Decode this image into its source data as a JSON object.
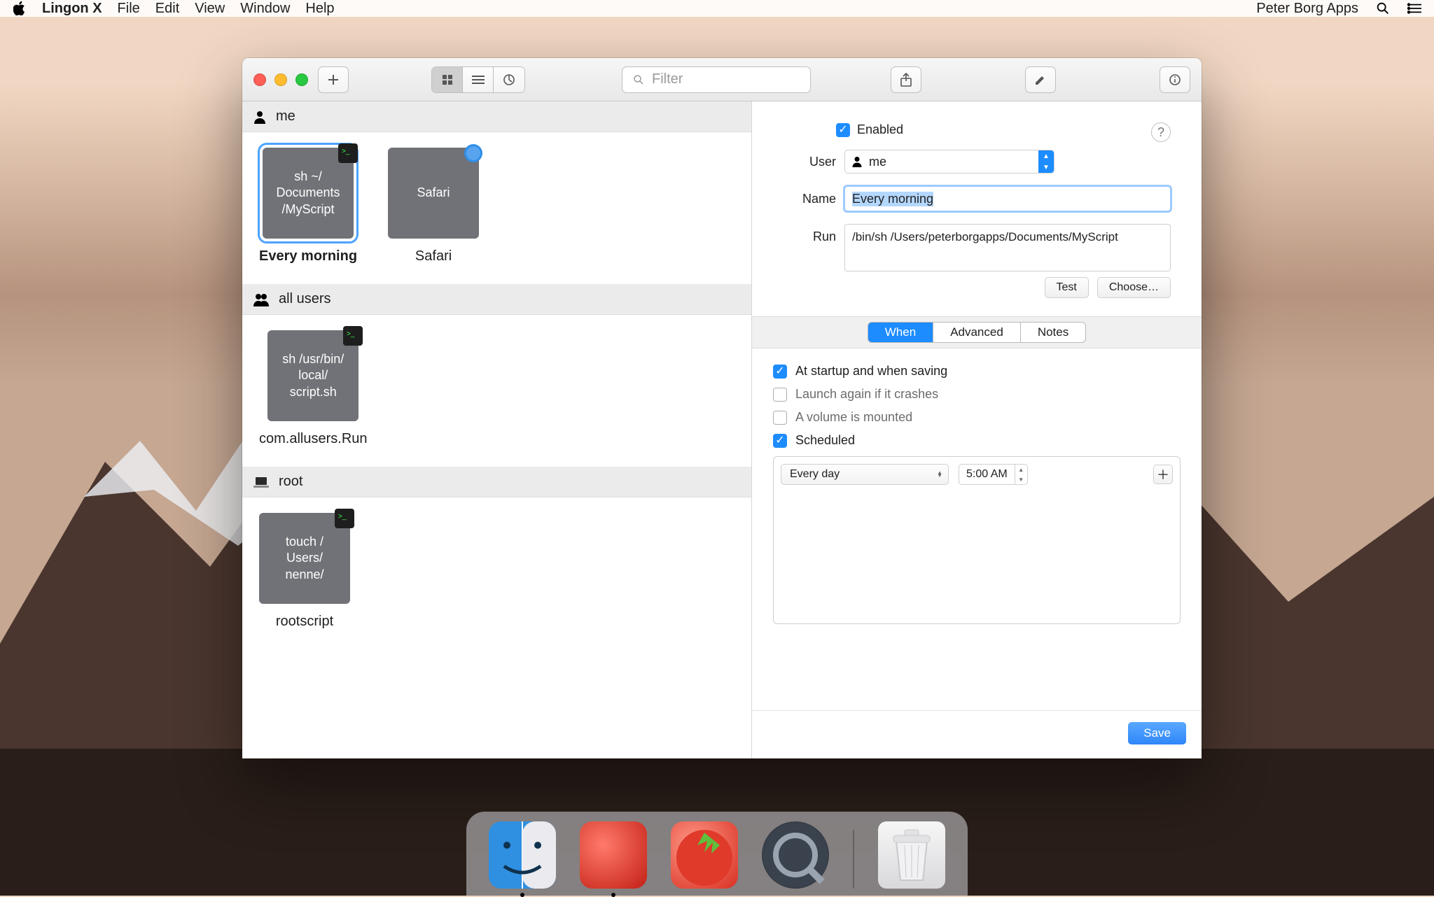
{
  "menubar": {
    "app_name": "Lingon X",
    "items": [
      "File",
      "Edit",
      "View",
      "Window",
      "Help"
    ],
    "right_label": "Peter Borg Apps"
  },
  "toolbar": {
    "filter_placeholder": "Filter"
  },
  "sections": [
    {
      "id": "me",
      "label": "me",
      "items": [
        {
          "id": "every-morning",
          "thumb_text": "sh ~/\nDocuments\n/MyScript",
          "label": "Every morning",
          "badge": "terminal",
          "selected": true
        },
        {
          "id": "safari",
          "thumb_text": "Safari",
          "label": "Safari",
          "badge": "safari",
          "selected": false
        }
      ]
    },
    {
      "id": "all-users",
      "label": "all users",
      "items": [
        {
          "id": "com-allusers-run",
          "thumb_text": "sh /usr/bin/\nlocal/\nscript.sh",
          "label": "com.allusers.Run",
          "badge": "terminal",
          "selected": false
        }
      ]
    },
    {
      "id": "root",
      "label": "root",
      "items": [
        {
          "id": "rootscript",
          "thumb_text": "touch /\nUsers/\nnenne/",
          "label": "rootscript",
          "badge": "terminal",
          "selected": false
        }
      ]
    }
  ],
  "detail": {
    "enabled_label": "Enabled",
    "enabled": true,
    "user_label": "User",
    "user_value": "me",
    "name_label": "Name",
    "name_value": "Every morning",
    "run_label": "Run",
    "run_value": "/bin/sh /Users/peterborgapps/Documents/MyScript",
    "test_label": "Test",
    "choose_label": "Choose…",
    "tabs": [
      "When",
      "Advanced",
      "Notes"
    ],
    "tab_selected": 0,
    "checks": [
      {
        "label": "At startup and when saving",
        "checked": true
      },
      {
        "label": "Launch again if it crashes",
        "checked": false
      },
      {
        "label": "A volume is mounted",
        "checked": false
      },
      {
        "label": "Scheduled",
        "checked": true
      }
    ],
    "schedule": {
      "frequency": "Every day",
      "time": "5:00 AM"
    },
    "save_label": "Save"
  },
  "dock": {
    "apps": [
      "Finder",
      "Tomato",
      "Tomato Assistant",
      "QuickTime"
    ],
    "trash": "Trash"
  }
}
